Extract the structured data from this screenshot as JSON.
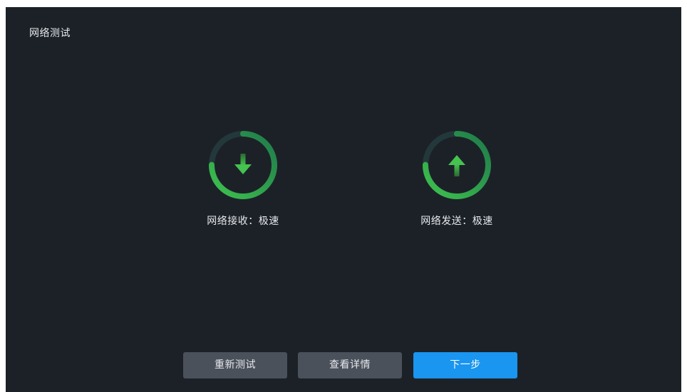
{
  "page": {
    "title": "网络测试"
  },
  "download": {
    "icon": "arrow-down-icon",
    "label": "网络接收：极速",
    "progress": 0.75
  },
  "upload": {
    "icon": "arrow-up-icon",
    "label": "网络发送：极速",
    "progress": 0.75
  },
  "buttons": {
    "retest": "重新测试",
    "details": "查看详情",
    "next": "下一步"
  },
  "colors": {
    "background": "#1c2128",
    "gauge_active": "#35b54a",
    "gauge_track": "#23383a",
    "secondary_button": "#4a515b",
    "primary_button": "#1a95f0"
  }
}
